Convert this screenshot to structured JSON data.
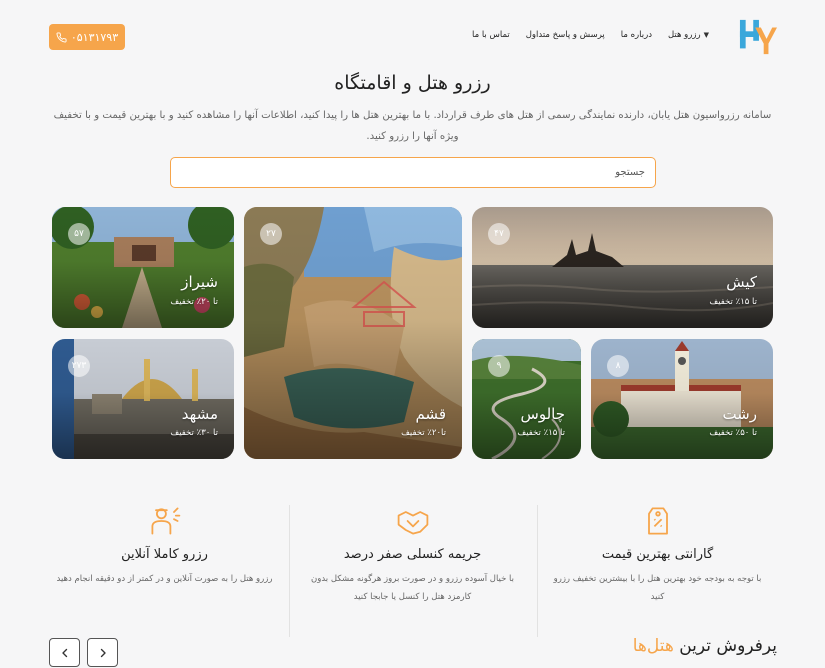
{
  "header": {
    "nav": [
      {
        "label": "رزرو هتل",
        "has_dropdown": true
      },
      {
        "label": "درباره ما"
      },
      {
        "label": "پرسش و پاسخ متداول"
      },
      {
        "label": "تماس با ما"
      }
    ],
    "phone": "۰۵۱۳۱۷۹۳"
  },
  "hero": {
    "title": "رزرو هتل و اقامتگاه",
    "description": "سامانه رزرواسیون هتل یابان، دارنده نمایندگی رسمی از هتل های طرف قرارداد. با ما بهترین هتل ها را پیدا کنید، اطلاعات آنها را مشاهده کنید و با بهترین قیمت و با تخفیف ویژه آنها را رزرو کنید.",
    "search_placeholder": "جستجو"
  },
  "cities": [
    {
      "name": "کیش",
      "discount": "تا ۱۵٪ تخفیف",
      "count": "۴۷"
    },
    {
      "name": "قشم",
      "discount": "تا۲۰٪ تخفیف",
      "count": "۲۷"
    },
    {
      "name": "شیراز",
      "discount": "تا ۲۰٪ تخفیف",
      "count": "۵۷"
    },
    {
      "name": "رشت",
      "discount": "تا ۵۰٪ تخفیف",
      "count": "۸"
    },
    {
      "name": "چالوس",
      "discount": "تا ۱۵٪ تخفیف",
      "count": "۹"
    },
    {
      "name": "مشهد",
      "discount": "تا ۳۰٪ تخفیف",
      "count": "۲۷۳"
    }
  ],
  "features": [
    {
      "icon": "price-tag-icon",
      "title": "گارانتی بهترین قیمت",
      "desc": "با توجه به بودجه خود بهترین هتل را با بیشترین تخفیف رزرو کنید"
    },
    {
      "icon": "handshake-icon",
      "title": "جریمه کنسلی صفر درصد",
      "desc": "با خیال آسوده رزرو و در صورت بروز هرگونه مشکل بدون کارمزد هتل را کنسل یا جابجا کنید"
    },
    {
      "icon": "receptionist-icon",
      "title": "رزرو کاملا آنلاین",
      "desc": "رزرو هتل را به صورت آنلاین و در کمتر از دو دقیقه انجام دهید"
    }
  ],
  "bestsellers": {
    "title_prefix": "پرفروش ترین",
    "title_highlight": "هتل‌ها"
  },
  "colors": {
    "accent": "#f6a54b",
    "logo_blue": "#3aa7db",
    "logo_orange": "#f6a54b"
  }
}
